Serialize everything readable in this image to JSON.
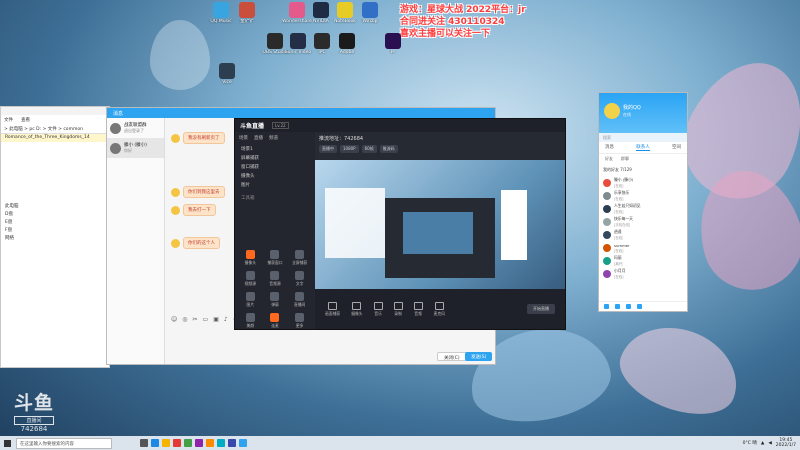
{
  "overlay": {
    "line1": "游戏：星球大战 2022平台：jr",
    "line2": "合同进关注 430110324",
    "line3": "喜欢主播可以关注一下"
  },
  "desktop_icons": [
    {
      "label": "QQ Music",
      "color": "#39a5e0"
    },
    {
      "label": "金铲铲",
      "color": "#c94f3c"
    },
    {
      "label": "Wondershare",
      "color": "#e35a8b"
    },
    {
      "label": "NVIDIA",
      "color": "#1f2a44"
    },
    {
      "label": "NoteBook",
      "color": "#e7cc28"
    },
    {
      "label": "Winzip",
      "color": "#3270c7"
    },
    {
      "label": "OBS Studio",
      "color": "#2a2a2a"
    },
    {
      "label": "Sonic Video",
      "color": "#252e47"
    },
    {
      "label": "IPC",
      "color": "#2b2b2b"
    },
    {
      "label": "Pr",
      "color": "#2a0f51"
    },
    {
      "label": "Adobe",
      "color": "#1b1b1b"
    },
    {
      "label": "Vice",
      "color": "#2c3e50"
    }
  ],
  "explorer": {
    "menu": [
      "文件",
      "查看"
    ],
    "address": "> 此电脑 > pc D: > 文件 > common",
    "rows": [
      "Romance_of_the_Three_Kingdoms_14",
      "此电脑",
      "D盘",
      "E盘",
      "F盘",
      "网络"
    ]
  },
  "chat": {
    "title": "消息",
    "contacts": [
      {
        "name": "战友联盟群",
        "preview": "退出登录了"
      },
      {
        "name": "滕小 (滕小)",
        "preview": "你好"
      }
    ],
    "messages": [
      "我没有刷新页了",
      "你们到我这里去",
      "我去打一下",
      "你们的这个人"
    ],
    "send_label": "发送(S)",
    "close_label": "关闭(C)"
  },
  "douyu": {
    "logo": "斗鱼直播",
    "level": "Lv.22",
    "tabs": [
      "场景",
      "直播",
      "频道"
    ],
    "scene_items": [
      "场景1",
      "屏幕捕获",
      "窗口捕获",
      "摄像头",
      "图片"
    ],
    "tools_title": "工具箱",
    "tools": [
      "摄像头",
      "捕获窗口",
      "全屏捕获",
      "视频源",
      "音频源",
      "文字",
      "图片",
      "弹幕",
      "直播间",
      "美颜",
      "连麦",
      "更多"
    ],
    "preview_title": "推流地址：742684",
    "preview_buttons": [
      "直播中",
      "1080P",
      "60帧",
      "推流码"
    ],
    "bottom_tools": [
      "画面捕获",
      "摄像头",
      "音乐",
      "录制",
      "音频",
      "麦克风"
    ],
    "start_label": "开始直播"
  },
  "qq": {
    "name": "我的QQ",
    "status": "在线",
    "search_placeholder": "搜索",
    "tabs": [
      "消息",
      "联系人",
      "空间"
    ],
    "subtabs": [
      "好友",
      "群聊"
    ],
    "group_header": "我的好友 7/129",
    "contacts": [
      {
        "name": "滕小 (滕小)",
        "msg": "[在线]"
      },
      {
        "name": "乐享快乐",
        "msg": "[在线]"
      },
      {
        "name": "人生若只如初见",
        "msg": "[在线]"
      },
      {
        "name": "快乐每一天",
        "msg": "[手机在线]"
      },
      {
        "name": "逍遥",
        "msg": "[在线]"
      },
      {
        "name": "summer",
        "msg": "[在线]"
      },
      {
        "name": "玛丽",
        "msg": "[离开]"
      },
      {
        "name": "小月月",
        "msg": "[在线]"
      }
    ]
  },
  "watermark": {
    "brand": "斗鱼",
    "badge": "直播间",
    "room": "742684"
  },
  "taskbar": {
    "search_placeholder": "在这里输入你要搜索的内容",
    "temperature": "0°C 晴",
    "time": "19:45",
    "date": "2022/1/7"
  }
}
